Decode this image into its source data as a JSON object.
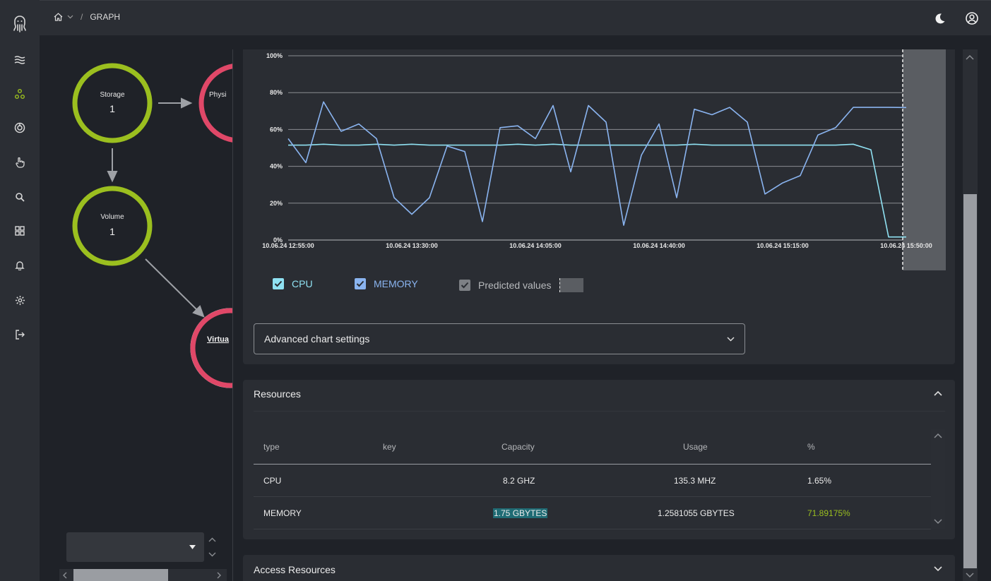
{
  "breadcrumb": {
    "current": "GRAPH"
  },
  "sidebar": {
    "items": [
      {
        "name": "logo-icon"
      },
      {
        "name": "layers-icon"
      },
      {
        "name": "graph-icon"
      },
      {
        "name": "power-icon"
      },
      {
        "name": "hand-pointer-icon"
      },
      {
        "name": "search-icon"
      },
      {
        "name": "dashboard-icon"
      },
      {
        "name": "bell-icon"
      },
      {
        "name": "gear-icon"
      },
      {
        "name": "logout-icon"
      }
    ]
  },
  "graph": {
    "nodes": [
      {
        "label": "Storage",
        "count": "1"
      },
      {
        "label": "Volume",
        "count": "1"
      },
      {
        "label": "Physi",
        "count": ""
      },
      {
        "label": "Virtua",
        "count": ""
      }
    ]
  },
  "chart_data": {
    "type": "line",
    "title": "",
    "xlabel": "",
    "ylabel": "",
    "ylim": [
      0,
      100
    ],
    "y_ticks": [
      "0%",
      "20%",
      "40%",
      "60%",
      "80%",
      "100%"
    ],
    "x_ticks": [
      "10.06.24 12:55:00",
      "10.06.24 13:30:00",
      "10.06.24 14:05:00",
      "10.06.24 14:40:00",
      "10.06.24 15:15:00",
      "10.06.24 15:50:00"
    ],
    "grid": true,
    "prediction_start": "10.06.24 15:50:00",
    "series": [
      {
        "name": "CPU",
        "color": "#8fe1f2",
        "x": [
          0,
          5,
          10,
          15,
          20,
          25,
          30,
          35,
          40,
          45,
          50,
          55,
          60,
          65,
          70,
          75,
          80,
          85,
          90,
          95,
          100,
          105,
          110,
          115,
          120,
          125,
          130,
          135,
          140,
          145,
          150,
          155,
          160,
          165,
          170,
          175
        ],
        "values": [
          51.5,
          51.5,
          52,
          51.5,
          51.5,
          52,
          51.5,
          52,
          51.5,
          51.5,
          51.5,
          51.5,
          51.5,
          52,
          51.5,
          52,
          51.5,
          51.5,
          51.5,
          51.5,
          51.5,
          51.5,
          51.5,
          52,
          51.5,
          51.5,
          51.5,
          51.5,
          51.5,
          51.5,
          51.5,
          51.5,
          52,
          49,
          1.65,
          1.65
        ]
      },
      {
        "name": "MEMORY",
        "color": "#8ab4f0",
        "x": [
          0,
          5,
          10,
          15,
          20,
          25,
          30,
          35,
          40,
          45,
          50,
          55,
          60,
          65,
          70,
          75,
          80,
          85,
          90,
          95,
          100,
          105,
          110,
          115,
          120,
          125,
          130,
          135,
          140,
          145,
          150,
          155,
          160,
          165,
          170,
          175
        ],
        "values": [
          55,
          42,
          75,
          59,
          63,
          55,
          23,
          14,
          23,
          51,
          48,
          10,
          61,
          62,
          55,
          73,
          37,
          73,
          64,
          8,
          46,
          63,
          23,
          71,
          68,
          72,
          64,
          25,
          31,
          35,
          57,
          61,
          72,
          72,
          72,
          71.9
        ]
      }
    ]
  },
  "legend": {
    "cpu_label": "CPU",
    "memory_label": "MEMORY",
    "predicted_label": "Predicted values"
  },
  "advanced_settings": {
    "label": "Advanced chart settings"
  },
  "resources": {
    "title": "Resources",
    "columns": [
      "type",
      "key",
      "Capacity",
      "Usage",
      "%"
    ],
    "rows": [
      {
        "type": "CPU",
        "key": "",
        "capacity": "8.2 GHZ",
        "usage": "135.3 MHZ",
        "percent": "1.65%"
      },
      {
        "type": "MEMORY",
        "key": "",
        "capacity": "1.75 GBYTES",
        "usage": "1.2581055 GBYTES",
        "percent": "71.89175%"
      }
    ]
  },
  "access_resources": {
    "title": "Access Resources"
  },
  "colors": {
    "accent_green": "#9bbf1f",
    "node_red": "#e04868",
    "cpu_line": "#8fe1f2",
    "memory_line": "#8ab4f0",
    "percent_green": "#9bbf1f",
    "highlight_teal": "#1f6b74"
  }
}
